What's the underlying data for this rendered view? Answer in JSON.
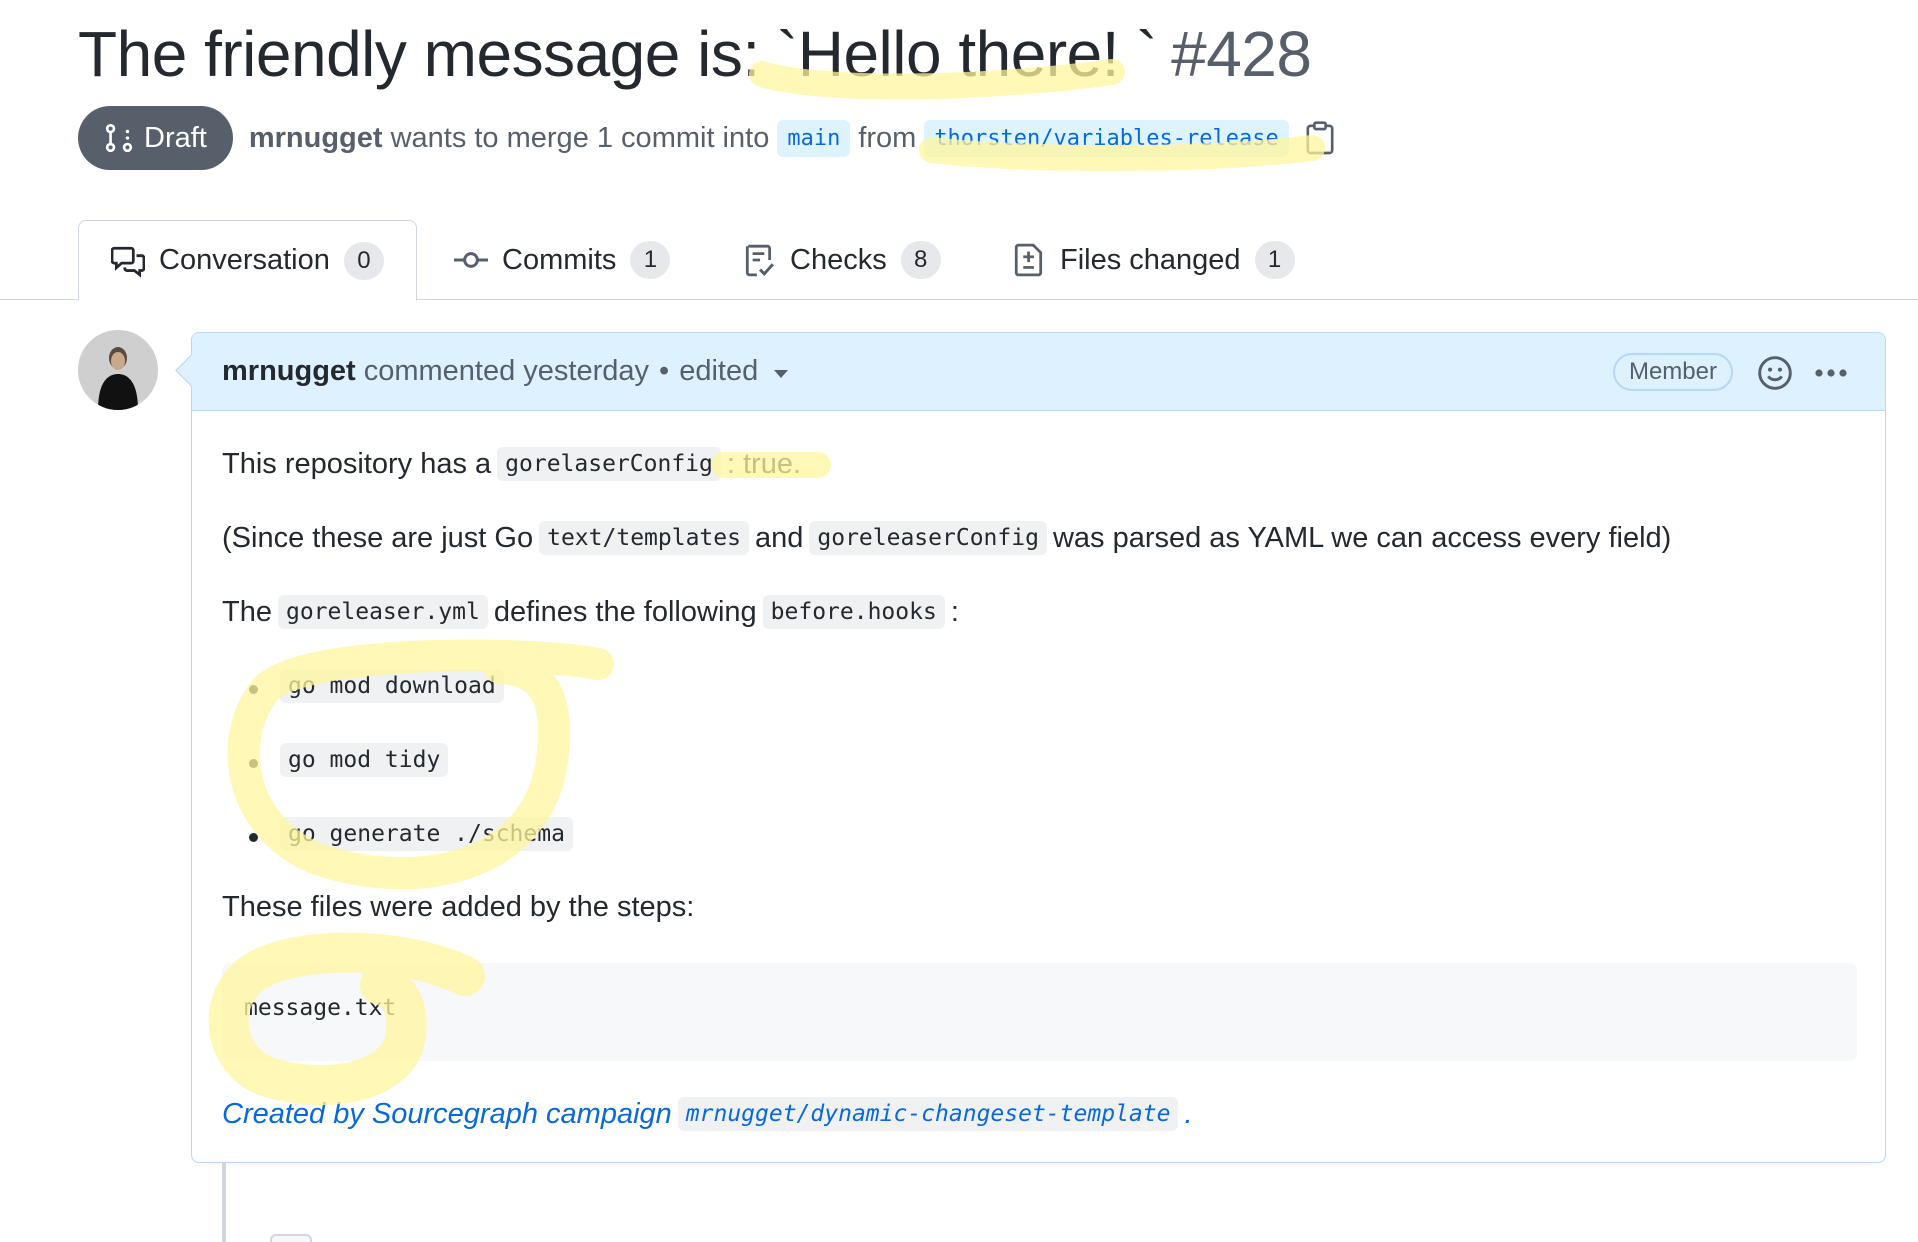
{
  "pr": {
    "title": "The friendly message is: `Hello there! `",
    "number": "#428",
    "state": "Draft",
    "author": "mrnugget",
    "merge_text": "wants to merge 1 commit into",
    "base_branch": "main",
    "from_text": "from",
    "head_branch": "thorsten/variables-release"
  },
  "tabs": [
    {
      "label": "Conversation",
      "count": "0",
      "icon": "comment-discussion-icon"
    },
    {
      "label": "Commits",
      "count": "1",
      "icon": "git-commit-icon"
    },
    {
      "label": "Checks",
      "count": "8",
      "icon": "checklist-icon"
    },
    {
      "label": "Files changed",
      "count": "1",
      "icon": "file-diff-icon"
    }
  ],
  "comment": {
    "author": "mrnugget",
    "action": "commented yesterday",
    "dot": "•",
    "edited": "edited",
    "badge": "Member",
    "line1": {
      "pre": "This repository has a",
      "code": "gorelaserConfig",
      "post": ": true."
    },
    "line2": {
      "pre": "(Since these are just Go",
      "code1": "text/templates",
      "mid": "and",
      "code2": "goreleaserConfig",
      "post": "was parsed as YAML we can access every field)"
    },
    "line3": {
      "pre": "The",
      "code1": "goreleaser.yml",
      "mid": "defines the following",
      "code2": "before.hooks",
      "post": ":"
    },
    "hooks": [
      "go mod download",
      "go mod tidy",
      "go generate ./schema"
    ],
    "files_intro": "These files were added by the steps:",
    "files_block": "message.txt",
    "footer": {
      "pre": "Created by Sourcegraph campaign",
      "code": "mrnugget/dynamic-changeset-template",
      "post": "."
    }
  },
  "colors": {
    "accent": "#0969da",
    "highlight": "#fff59d",
    "draft": "#57606a"
  }
}
